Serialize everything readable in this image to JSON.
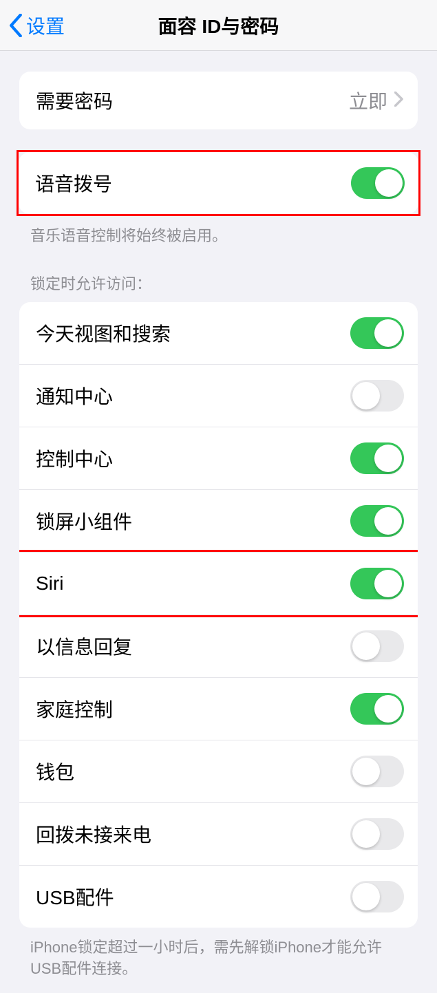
{
  "nav": {
    "back_label": "设置",
    "title": "面容 ID与密码"
  },
  "require_passcode": {
    "label": "需要密码",
    "value": "立即"
  },
  "voice_dial": {
    "label": "语音拨号",
    "on": true,
    "footer": "音乐语音控制将始终被启用。"
  },
  "allow_access": {
    "header": "锁定时允许访问：",
    "items": [
      {
        "label": "今天视图和搜索",
        "on": true
      },
      {
        "label": "通知中心",
        "on": false
      },
      {
        "label": "控制中心",
        "on": true
      },
      {
        "label": "锁屏小组件",
        "on": true
      },
      {
        "label": "Siri",
        "on": true,
        "highlight": true
      },
      {
        "label": "以信息回复",
        "on": false
      },
      {
        "label": "家庭控制",
        "on": true
      },
      {
        "label": "钱包",
        "on": false
      },
      {
        "label": "回拨未接来电",
        "on": false
      },
      {
        "label": "USB配件",
        "on": false
      }
    ],
    "footer": "iPhone锁定超过一小时后，需先解锁iPhone才能允许USB配件连接。"
  }
}
